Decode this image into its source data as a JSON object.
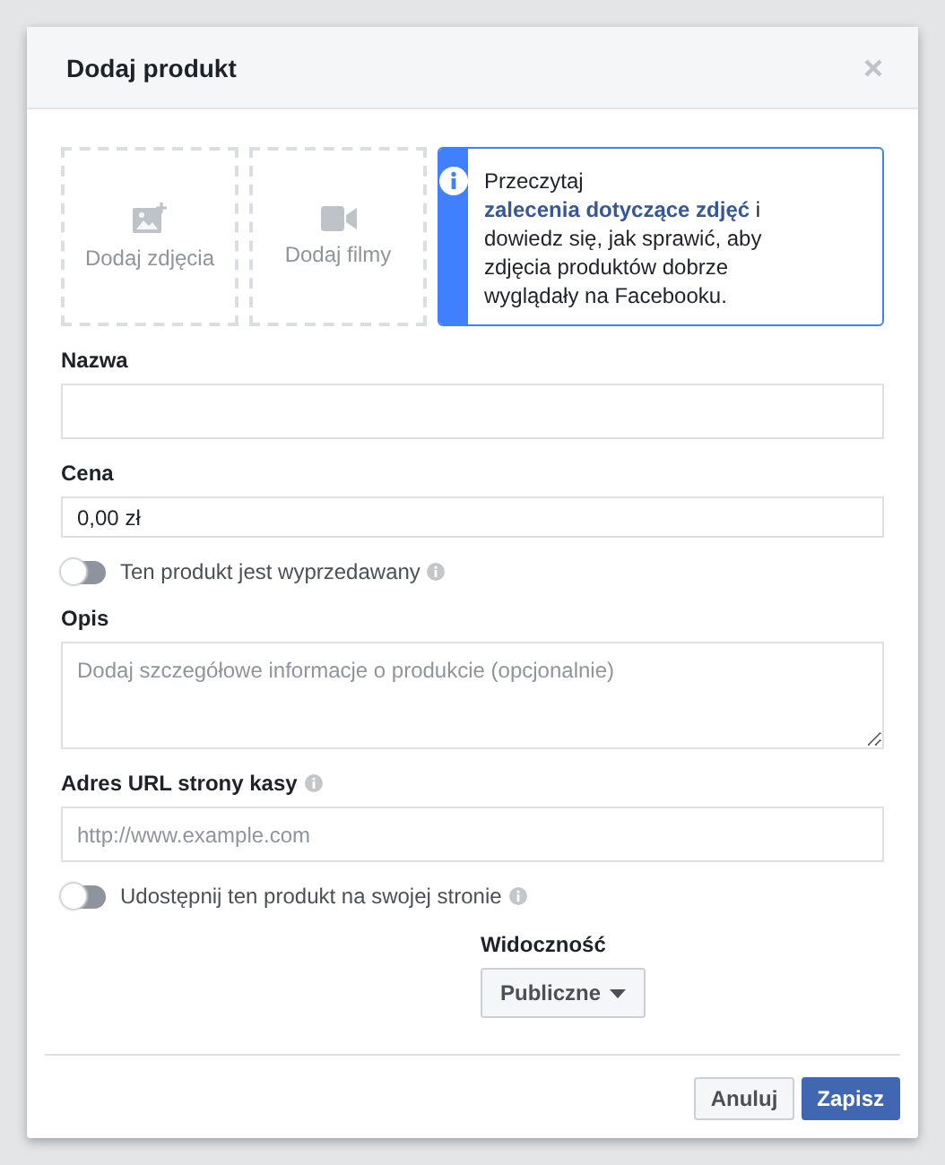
{
  "dialog": {
    "title": "Dodaj produkt"
  },
  "media": [
    {
      "kind": "photo",
      "label": "Dodaj zdjęcia"
    },
    {
      "kind": "video",
      "label": "Dodaj filmy"
    }
  ],
  "info": {
    "before": "Przeczytaj ",
    "link": "zalecenia dotyczące zdjęć",
    "after": " i dowiedz się, jak sprawić, aby zdjęcia produktów dobrze wyglądały na Facebooku."
  },
  "form": [
    {
      "kind": "input",
      "label": "Nazwa",
      "tall": true
    },
    {
      "kind": "input",
      "label": "Cena",
      "value": "0,00 zł",
      "tall": false
    },
    {
      "kind": "toggle",
      "label": "Ten produkt jest wyprzedawany",
      "on": false
    },
    {
      "kind": "textarea",
      "label": "Opis",
      "placeholder": "Dodaj szczegółowe informacje o produkcie (opcjonalnie)"
    },
    {
      "kind": "input",
      "label": "Adres URL strony kasy",
      "placeholder": "http://www.example.com",
      "tall": true,
      "info": true
    },
    {
      "kind": "toggle",
      "label": "Udostępnij ten produkt na swojej stronie",
      "on": false
    },
    {
      "kind": "select",
      "label": "Widoczność",
      "value": "Publiczne"
    }
  ],
  "buttons": [
    {
      "label": "Anuluj",
      "kind": "secondary"
    },
    {
      "label": "Zapisz",
      "kind": "primary"
    }
  ]
}
